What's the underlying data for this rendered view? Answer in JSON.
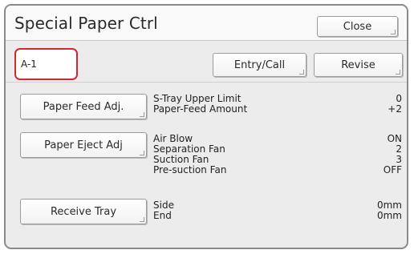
{
  "window": {
    "title": "Special Paper Ctrl",
    "close_label": "Close"
  },
  "entry": {
    "name": "A-1",
    "entry_call_label": "Entry/Call",
    "revise_label": "Revise"
  },
  "sections": [
    {
      "button_label": "Paper Feed Adj.",
      "rows": [
        {
          "label": "S-Tray Upper Limit",
          "value": "0"
        },
        {
          "label": "Paper-Feed Amount",
          "value": "+2"
        }
      ]
    },
    {
      "button_label": "Paper Eject Adj",
      "rows": [
        {
          "label": "Air Blow",
          "value": "ON"
        },
        {
          "label": "Separation Fan",
          "value": "2"
        },
        {
          "label": "Suction Fan",
          "value": "3"
        },
        {
          "label": "Pre-suction Fan",
          "value": "OFF"
        }
      ]
    },
    {
      "button_label": "Receive Tray",
      "rows": [
        {
          "label": "Side",
          "value": "0mm"
        },
        {
          "label": "End",
          "value": "0mm"
        }
      ]
    }
  ],
  "colors": {
    "highlight": "#d3262f",
    "panel": "#ececec"
  }
}
